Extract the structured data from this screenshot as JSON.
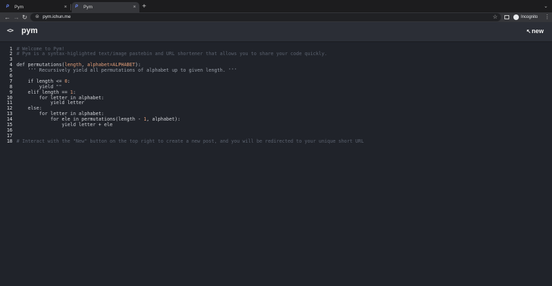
{
  "browser": {
    "tabs": [
      {
        "title": "Pym",
        "favicon": "P",
        "close": "×"
      },
      {
        "title": "Pym",
        "favicon": "P",
        "close": "×"
      }
    ],
    "new_tab": "+",
    "tab_menu": "⌄",
    "url": "pym.ichun.me",
    "profile_label": "Incognito"
  },
  "app": {
    "logo": "<>",
    "title": "pym",
    "new_label": "new"
  },
  "editor": {
    "lines": [
      {
        "n": "1",
        "segs": [
          {
            "c": "cm",
            "t": "# Welcome to Pym!"
          }
        ]
      },
      {
        "n": "2",
        "segs": [
          {
            "c": "cm",
            "t": "# Pym is a syntax-higlighted text/image pastebin and URL shortener that allows you to share your code quickly."
          }
        ]
      },
      {
        "n": "3",
        "segs": []
      },
      {
        "n": "4",
        "segs": [
          {
            "c": "kw",
            "t": "def "
          },
          {
            "c": "fn",
            "t": "permutations("
          },
          {
            "c": "nm",
            "t": "length"
          },
          {
            "c": "fn",
            "t": ", "
          },
          {
            "c": "nm",
            "t": "alphabet=ALPHABET"
          },
          {
            "c": "fn",
            "t": "):"
          }
        ]
      },
      {
        "n": "5",
        "segs": [
          {
            "c": "str",
            "t": "    ''' Recursively yield all permutations of alphabet up to given length. '''"
          }
        ]
      },
      {
        "n": "6",
        "segs": []
      },
      {
        "n": "7",
        "segs": [
          {
            "c": "kw",
            "t": "    if "
          },
          {
            "c": "fn",
            "t": "length <= "
          },
          {
            "c": "nm",
            "t": "0"
          },
          {
            "c": "fn",
            "t": ":"
          }
        ]
      },
      {
        "n": "8",
        "segs": [
          {
            "c": "kw",
            "t": "        yield "
          },
          {
            "c": "str",
            "t": "\"\""
          }
        ]
      },
      {
        "n": "9",
        "segs": [
          {
            "c": "kw",
            "t": "    elif "
          },
          {
            "c": "fn",
            "t": "length == "
          },
          {
            "c": "nm",
            "t": "1"
          },
          {
            "c": "fn",
            "t": ":"
          }
        ]
      },
      {
        "n": "10",
        "segs": [
          {
            "c": "kw",
            "t": "        for "
          },
          {
            "c": "fn",
            "t": "letter "
          },
          {
            "c": "kw",
            "t": "in "
          },
          {
            "c": "fn",
            "t": "alphabet:"
          }
        ]
      },
      {
        "n": "11",
        "segs": [
          {
            "c": "kw",
            "t": "            yield "
          },
          {
            "c": "fn",
            "t": "letter"
          }
        ]
      },
      {
        "n": "12",
        "segs": [
          {
            "c": "kw",
            "t": "    else:"
          }
        ]
      },
      {
        "n": "13",
        "segs": [
          {
            "c": "kw",
            "t": "        for "
          },
          {
            "c": "fn",
            "t": "letter "
          },
          {
            "c": "kw",
            "t": "in "
          },
          {
            "c": "fn",
            "t": "alphabet:"
          }
        ]
      },
      {
        "n": "14",
        "segs": [
          {
            "c": "kw",
            "t": "            for "
          },
          {
            "c": "fn",
            "t": "ele "
          },
          {
            "c": "kw",
            "t": "in "
          },
          {
            "c": "fn",
            "t": "permutations(length - "
          },
          {
            "c": "nm",
            "t": "1"
          },
          {
            "c": "fn",
            "t": ", alphabet):"
          }
        ]
      },
      {
        "n": "15",
        "segs": [
          {
            "c": "kw",
            "t": "                yield "
          },
          {
            "c": "fn",
            "t": "letter + ele"
          }
        ]
      },
      {
        "n": "16",
        "segs": []
      },
      {
        "n": "17",
        "segs": []
      },
      {
        "n": "18",
        "segs": [
          {
            "c": "cm",
            "t": "# Interact with the \"New\" button on the top right to create a new post, and you will be redirected to your unique short URL"
          }
        ]
      }
    ]
  },
  "colors": {
    "background": "#20232a",
    "header": "#2b2e36",
    "comment": "#5c6370",
    "number_param": "#e5a07a"
  }
}
